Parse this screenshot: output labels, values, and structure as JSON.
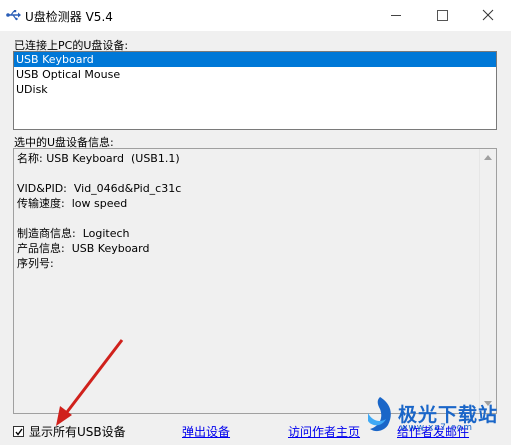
{
  "window": {
    "title": "U盘检测器 V5.4",
    "icon": "usb-icon"
  },
  "devices": {
    "label": "已连接上PC的U盘设备:",
    "items": [
      "USB Keyboard",
      "USB Optical Mouse",
      "UDisk"
    ],
    "selected": "USB Keyboard"
  },
  "info": {
    "label": "选中的U盘设备信息:",
    "lines": [
      "名称: USB Keyboard  (USB1.1)",
      "",
      "VID&PID:  Vid_046d&Pid_c31c",
      "传输速度:  low speed",
      "",
      "制造商信息:  Logitech",
      "产品信息:  USB Keyboard",
      "序列号:"
    ]
  },
  "footer": {
    "show_all_label": "显示所有USB设备",
    "show_all_checked": true,
    "eject_link": "弹出设备",
    "visit_link": "访问作者主页",
    "mail_link": "给作者发邮件"
  },
  "watermark": {
    "text": "极光下载站",
    "url": "www.xz7.com"
  },
  "colors": {
    "selection": "#0078d7",
    "link": "#0000ee",
    "arrow": "#d0211c",
    "watermark": "#1a66c8"
  }
}
